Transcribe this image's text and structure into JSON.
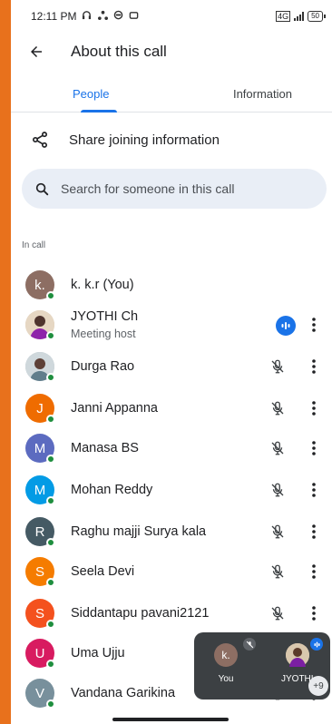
{
  "status_bar": {
    "time": "12:11 PM",
    "notification_icons": [
      "headphones-icon",
      "network-icon",
      "app-icon",
      "app-icon-2"
    ],
    "sim_label": "4G",
    "battery": "50"
  },
  "header": {
    "title": "About this call",
    "back_icon": "arrow-back-icon"
  },
  "tabs": [
    {
      "label": "People",
      "active": true
    },
    {
      "label": "Information",
      "active": false
    }
  ],
  "share": {
    "label": "Share joining information",
    "icon": "share-icon"
  },
  "search": {
    "placeholder": "Search for someone in this call",
    "value": ""
  },
  "section_label": "In call",
  "participants": [
    {
      "name": "k. k.r (You)",
      "subtitle": "",
      "initial": "k.",
      "color": "#8d6e63",
      "photo": false,
      "mic": "none",
      "menu": false
    },
    {
      "name": "JYOTHI Ch",
      "subtitle": "Meeting host",
      "initial": "",
      "color": "#d7c3a8",
      "photo": true,
      "mic": "speaking",
      "menu": true
    },
    {
      "name": "Durga Rao",
      "subtitle": "",
      "initial": "",
      "color": "#b0bec5",
      "photo": true,
      "mic": "muted",
      "menu": true
    },
    {
      "name": "Janni Appanna",
      "subtitle": "",
      "initial": "J",
      "color": "#ef6c00",
      "photo": false,
      "mic": "muted",
      "menu": true
    },
    {
      "name": "Manasa BS",
      "subtitle": "",
      "initial": "M",
      "color": "#5c6bc0",
      "photo": false,
      "mic": "muted",
      "menu": true
    },
    {
      "name": "Mohan Reddy",
      "subtitle": "",
      "initial": "M",
      "color": "#039be5",
      "photo": false,
      "mic": "muted",
      "menu": true
    },
    {
      "name": "Raghu majji Surya kala",
      "subtitle": "",
      "initial": "R",
      "color": "#455a64",
      "photo": false,
      "mic": "muted",
      "menu": true
    },
    {
      "name": "Seela Devi",
      "subtitle": "",
      "initial": "S",
      "color": "#f57c00",
      "photo": false,
      "mic": "muted",
      "menu": true
    },
    {
      "name": "Siddantapu pavani2121",
      "subtitle": "",
      "initial": "S",
      "color": "#f4511e",
      "photo": false,
      "mic": "muted",
      "menu": true
    },
    {
      "name": "Uma Ujju",
      "subtitle": "",
      "initial": "U",
      "color": "#d81b60",
      "photo": false,
      "mic": "muted",
      "menu": true
    },
    {
      "name": "Vandana Garikina",
      "subtitle": "",
      "initial": "V",
      "color": "#78909c",
      "photo": false,
      "mic": "muted",
      "menu": true
    }
  ],
  "pip": {
    "self_initial": "k.",
    "self_label": "You",
    "other_label": "JYOTHI",
    "more_count": "+9"
  },
  "colors": {
    "accent": "#1a73e8",
    "online": "#1e8e3e",
    "frame": "#e8711c"
  }
}
